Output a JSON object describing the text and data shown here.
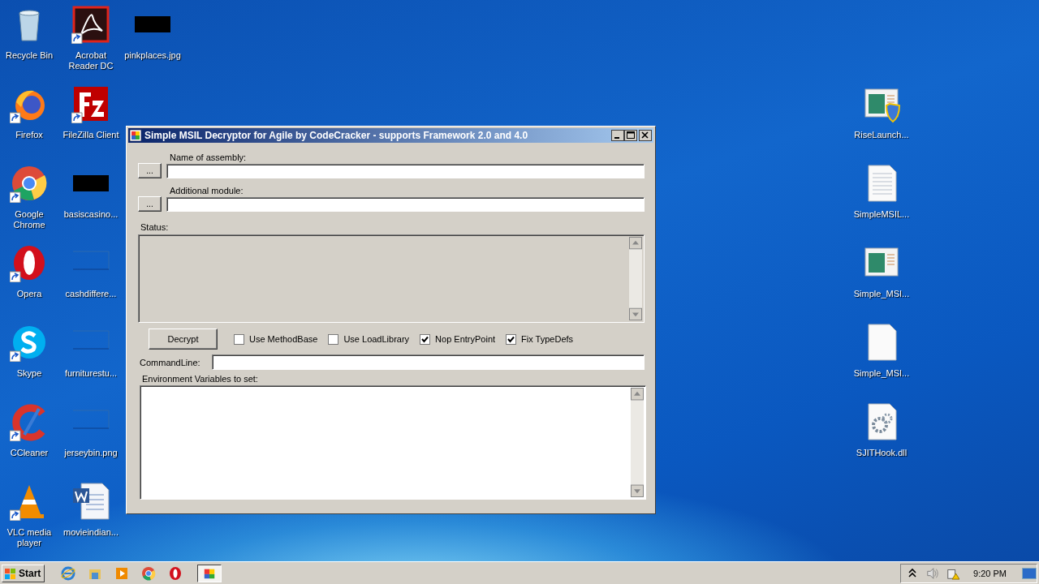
{
  "desktop": {
    "left_columns": [
      [
        {
          "label": "Recycle Bin",
          "kind": "recycle",
          "shortcut": false
        },
        {
          "label": "Firefox",
          "kind": "firefox",
          "shortcut": true
        },
        {
          "label": "Google Chrome",
          "kind": "chrome",
          "shortcut": true
        },
        {
          "label": "Opera",
          "kind": "opera",
          "shortcut": true
        },
        {
          "label": "Skype",
          "kind": "skype",
          "shortcut": true
        },
        {
          "label": "CCleaner",
          "kind": "ccleaner",
          "shortcut": true
        },
        {
          "label": "VLC media player",
          "kind": "vlc",
          "shortcut": true
        }
      ],
      [
        {
          "label": "Acrobat Reader DC",
          "kind": "acrobat",
          "shortcut": true
        },
        {
          "label": "FileZilla Client",
          "kind": "filezilla",
          "shortcut": true
        },
        {
          "label": "basiscasino...",
          "kind": "dark-image",
          "shortcut": false
        },
        {
          "label": "cashdiffere...",
          "kind": "blank-image",
          "shortcut": false
        },
        {
          "label": "furniturestu...",
          "kind": "blank-image",
          "shortcut": false
        },
        {
          "label": "jerseybin.png",
          "kind": "blank-image",
          "shortcut": false
        },
        {
          "label": "movieindian...",
          "kind": "word",
          "shortcut": false
        }
      ],
      [
        {
          "label": "pinkplaces.jpg",
          "kind": "dark-image",
          "shortcut": false
        }
      ]
    ],
    "right_column": [
      {
        "label": "RiseLaunch...",
        "kind": "exe-shield",
        "shortcut": false
      },
      {
        "label": "SimpleMSIL...",
        "kind": "text",
        "shortcut": false
      },
      {
        "label": "Simple_MSI...",
        "kind": "exe",
        "shortcut": false
      },
      {
        "label": "Simple_MSI...",
        "kind": "blank-file",
        "shortcut": false
      },
      {
        "label": "SJITHook.dll",
        "kind": "dll",
        "shortcut": false
      }
    ]
  },
  "window": {
    "title": "Simple MSIL Decryptor for Agile by CodeCracker - supports Framework 2.0 and 4.0",
    "file_fields": [
      {
        "label": "Name of assembly:",
        "button": "..."
      },
      {
        "label": "Additional module:",
        "button": "..."
      }
    ],
    "status_label": "Status:",
    "decrypt_button": "Decrypt",
    "options": [
      {
        "label": "Use MethodBase",
        "checked": false
      },
      {
        "label": "Use LoadLibrary",
        "checked": false
      },
      {
        "label": "Nop EntryPoint",
        "checked": true
      },
      {
        "label": "Fix TypeDefs",
        "checked": true
      }
    ],
    "command_line_label": "CommandLine:",
    "environment_label": "Environment Variables to set:"
  },
  "taskbar": {
    "start": "Start",
    "quick_launch": [
      {
        "kind": "ie"
      },
      {
        "kind": "folder"
      },
      {
        "kind": "media"
      },
      {
        "kind": "chrome"
      },
      {
        "kind": "opera"
      }
    ],
    "windows": [
      {
        "selected": true
      }
    ],
    "clock": "9:20 PM"
  }
}
